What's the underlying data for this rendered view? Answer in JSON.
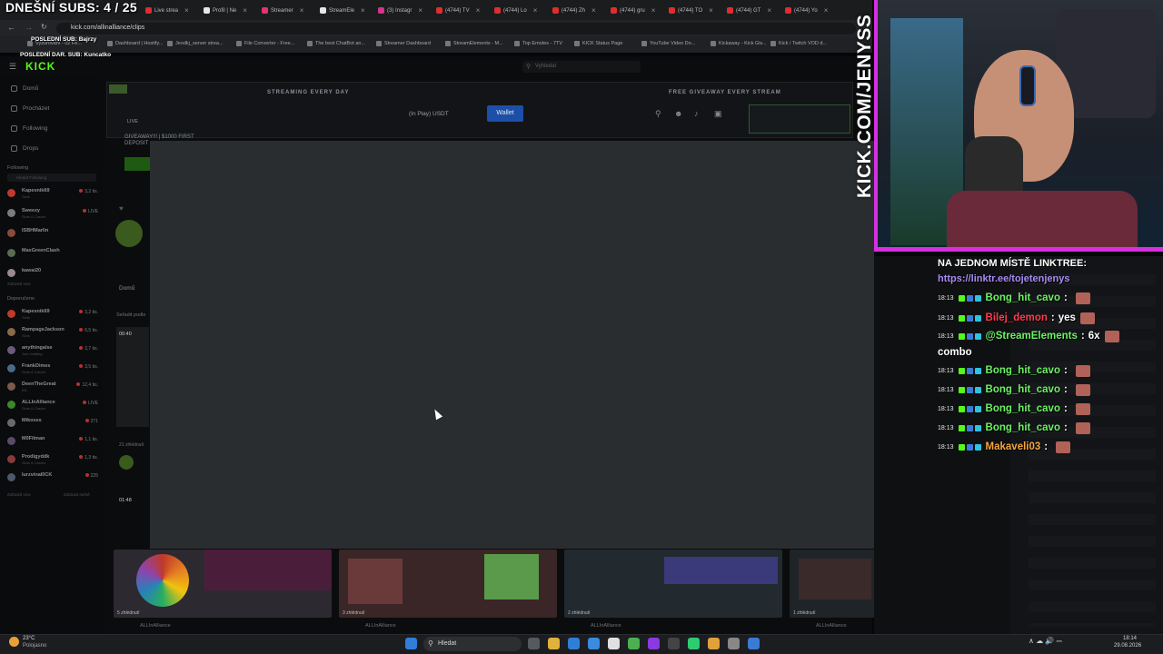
{
  "overlay": {
    "subs": "DNEŠNÍ SUBS: 4 / 25",
    "last_sub": "POSLEDNÍ SUB: Bajrzy",
    "last_gift": "POSLEDNÍ DAR. SUB: Kuncatko"
  },
  "browser": {
    "tabs": [
      {
        "label": "Live strea",
        "color": "#e02d2d"
      },
      {
        "label": "Profil | Ne",
        "color": "#e6e6e6"
      },
      {
        "label": "Streamer",
        "color": "#e0356b"
      },
      {
        "label": "StreamEle",
        "color": "#e6e6e6"
      },
      {
        "label": "(3) Instagr",
        "color": "#d6338a"
      },
      {
        "label": "(4744) TV",
        "color": "#e02d2d"
      },
      {
        "label": "(4744) Lo",
        "color": "#e02d2d"
      },
      {
        "label": "(4744) Zh",
        "color": "#e02d2d"
      },
      {
        "label": "(4744) gru",
        "color": "#e02d2d"
      },
      {
        "label": "(4744) TO",
        "color": "#e02d2d"
      },
      {
        "label": "(4744) GT",
        "color": "#e02d2d"
      },
      {
        "label": "(4744) Yo",
        "color": "#e02d2d"
      }
    ],
    "url": "kick.com/allinalliance/clips",
    "bookmarks": [
      {
        "label": "Vyzurovaní - 02 Fe..."
      },
      {
        "label": "Dashboard | Hostify..."
      },
      {
        "label": "Jeodkj_server strea..."
      },
      {
        "label": "File Converter - Free..."
      },
      {
        "label": "The best ChatBot an..."
      },
      {
        "label": "Streamer Dashboard"
      },
      {
        "label": "StreamElements - M..."
      },
      {
        "label": "Top Emotes - 7TV"
      },
      {
        "label": "KICK Status Page"
      },
      {
        "label": "YouTube Video Do..."
      },
      {
        "label": "Kickaway - Kick Giv..."
      },
      {
        "label": "Kick / Twitch VOD d..."
      }
    ]
  },
  "kick": {
    "search_placeholder": "Vyhledat",
    "nav": [
      "Domů",
      "Procházet",
      "Following",
      "Drops"
    ],
    "following_header": "Following",
    "following_search": "Hledat Following",
    "following": [
      {
        "name": "Kapesnik69",
        "sub": "Slots",
        "viewers": "3,2 tis.",
        "color": "#c0392b"
      },
      {
        "name": "Sweezy",
        "sub": "Slots & Casino",
        "viewers": "LIVE",
        "color": "#7a7d80"
      },
      {
        "name": "ISBHMarlin",
        "sub": "",
        "viewers": "",
        "color": "#8a4a3a"
      },
      {
        "name": "MaxGreenClash",
        "sub": "",
        "viewers": "",
        "color": "#5a6d52"
      },
      {
        "name": "kawai20",
        "sub": "",
        "viewers": "",
        "color": "#9a8a90"
      }
    ],
    "show_more": "Zobrazit více",
    "recommended_header": "Doporučeno",
    "recommended": [
      {
        "name": "Kapesnik69",
        "sub": "Slots",
        "viewers": "3,2 tis.",
        "color": "#c0392b"
      },
      {
        "name": "RampageJackson",
        "sub": "Slots",
        "viewers": "6,5 tis.",
        "color": "#8a6a4a"
      },
      {
        "name": "anythingalse",
        "sub": "Just chatting",
        "viewers": "2,7 tis.",
        "color": "#6d5a7a"
      },
      {
        "name": "FrankDimes",
        "sub": "Slots & Casino",
        "viewers": "3,5 tis.",
        "color": "#4a6a8a"
      },
      {
        "name": "DeenTheGreat",
        "sub": "IRL",
        "viewers": "12,4 tis.",
        "color": "#7a5a4a"
      },
      {
        "name": "ALLInAlliance",
        "sub": "Slots & Casino",
        "viewers": "LIVE",
        "color": "#3a8a2a"
      },
      {
        "name": "Mikoses",
        "sub": "",
        "viewers": "271",
        "color": "#6a6a6a"
      },
      {
        "name": "M0Filman",
        "sub": "",
        "viewers": "1,1 tis.",
        "color": "#5a4a6a"
      },
      {
        "name": "Prodigyddk",
        "sub": "Slots & Casino",
        "viewers": "1,3 tis.",
        "color": "#8a3a3a"
      },
      {
        "name": "lurzvinal0CK",
        "sub": "",
        "viewers": "225",
        "color": "#4a5a6a"
      }
    ],
    "show_less": "Zobrazit více",
    "show_less2": "Zobrazit méně",
    "banner_left": "STREAMING EVERY DAY",
    "banner_right": "FREE GIVEAWAY EVERY STREAM",
    "currency": "(In Play)  USDT",
    "wallet_btn": "Wallet",
    "live_label": "LIVE",
    "giveaway": "GIVEAWAY!!! | $1000 FIRST DEPOSIT",
    "tabs_label": "Domů",
    "sort_label": "Seřadit podle",
    "clip_time1": "00:40",
    "clip_time2": "01:48",
    "views1": "21 zhlédnutí",
    "thumb_caps": [
      "5 zhlédnutí",
      "3 zhlédnutí",
      "2 zhlédnutí",
      "1 zhlédnutí"
    ],
    "thumb_names": [
      "ALLInAlliance",
      "ALLInAlliance",
      "ALLInAlliance",
      "ALLInAlliance"
    ]
  },
  "stream_overlay": {
    "kick_vertical": "KICK.COM/JENYSS",
    "chat_header": "NA JEDNOM MÍSTĚ LINKTREE:",
    "chat_link": "https://linktr.ee/tojetenjenys",
    "messages": [
      {
        "time": "18:13",
        "user": "Bong_hit_cavo",
        "text": "",
        "color": "#6cf263",
        "emote": true
      },
      {
        "time": "18:13",
        "user": "Bilej_demon",
        "text": "yes",
        "color": "#ff3b4e",
        "emote": true
      },
      {
        "time": "18:13",
        "user": "@StreamElements",
        "text": "6x",
        "color": "#6cf263",
        "emote": true
      },
      {
        "time": "18:13",
        "user": "Bong_hit_cavo",
        "text": "",
        "color": "#6cf263",
        "emote": true
      },
      {
        "time": "18:13",
        "user": "Bong_hit_cavo",
        "text": "",
        "color": "#6cf263",
        "emote": true
      },
      {
        "time": "18:13",
        "user": "Bong_hit_cavo",
        "text": "",
        "color": "#6cf263",
        "emote": true
      },
      {
        "time": "18:13",
        "user": "Bong_hit_cavo",
        "text": "",
        "color": "#6cf263",
        "emote": true
      },
      {
        "time": "18:13",
        "user": "Makaveli03",
        "text": "",
        "color": "#f5a53a",
        "emote": true
      }
    ],
    "combo": "combo",
    "chat_colors": {
      "kick_green": "#53fc18",
      "frame_magenta": "#d62fe0"
    }
  },
  "taskbar": {
    "weather_temp": "23°C",
    "weather_desc": "Polojasno",
    "search": "Hledat",
    "time": "18:14",
    "date": "29.08.2026"
  }
}
